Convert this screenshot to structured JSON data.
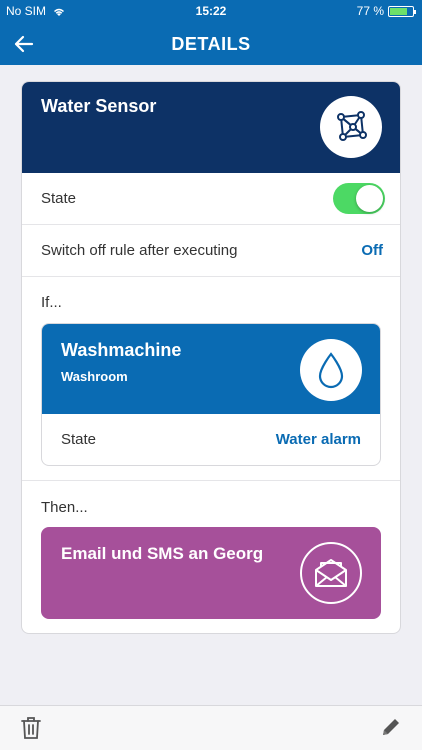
{
  "status_bar": {
    "carrier": "No SIM",
    "time": "15:22",
    "battery": "77 %",
    "battery_level": 0.77
  },
  "nav": {
    "title": "DETAILS",
    "back_icon": "arrow-left-icon"
  },
  "rule": {
    "title": "Water Sensor",
    "icon": "network-icon",
    "state_label": "State",
    "state_on": true,
    "switch_off_label": "Switch off rule after executing",
    "switch_off_value": "Off"
  },
  "if_section": {
    "label": "If...",
    "device": {
      "title": "Washmachine",
      "room": "Washroom",
      "icon": "water-drop-icon",
      "state_label": "State",
      "state_value": "Water alarm"
    }
  },
  "then_section": {
    "label": "Then...",
    "action": {
      "title": "Email und SMS an Georg",
      "icon": "envelope-icon"
    }
  },
  "toolbar": {
    "delete_icon": "trash-icon",
    "edit_icon": "pencil-icon"
  },
  "colors": {
    "header": "#0a6bb3",
    "rule_head": "#0d3266",
    "toggle_on": "#4cd964",
    "action": "#a6509a",
    "accent_text": "#0a6bb3"
  }
}
